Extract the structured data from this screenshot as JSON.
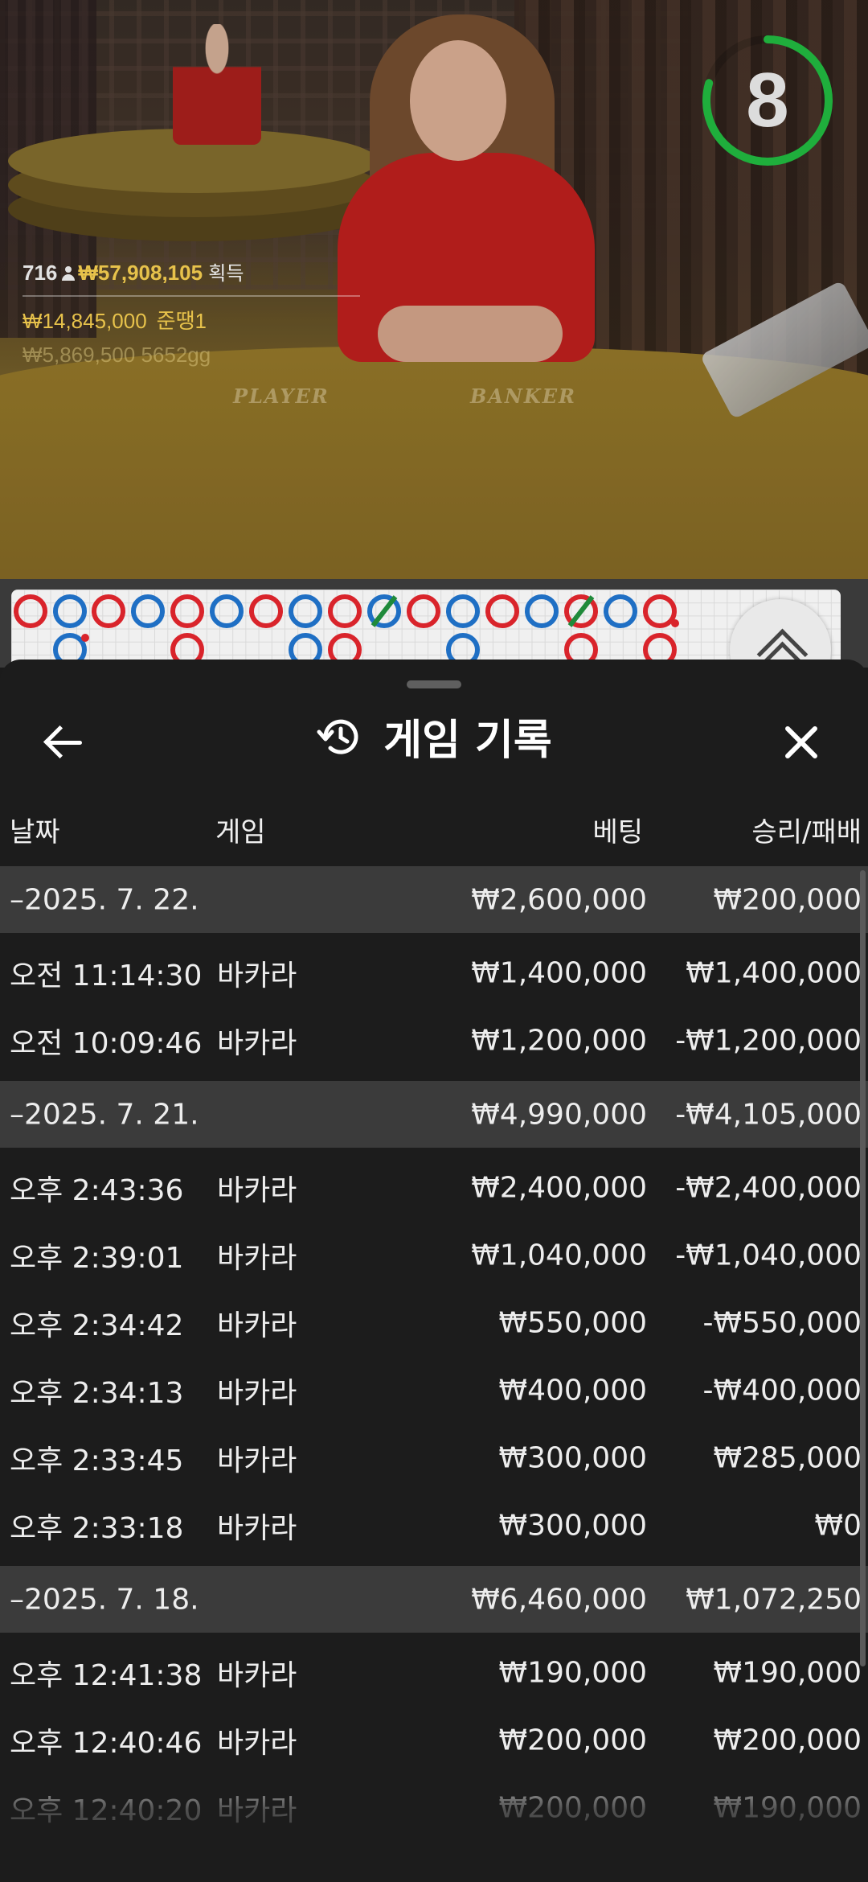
{
  "video": {
    "countdown": "8",
    "stats": {
      "players": "716",
      "total_win": "₩57,908,105",
      "total_win_label": "획득",
      "top_win_amount": "₩14,845,000",
      "top_win_user": "준땡1",
      "second_win_amount": "₩5,869,500",
      "second_win_user": "5652gg"
    },
    "table_labels": {
      "player": "PLAYER",
      "banker": "BANKER"
    }
  },
  "bead_road": {
    "colors": {
      "banker": "#d9242b",
      "player": "#1f6fc4",
      "tie": "#1f8a3a"
    }
  },
  "history": {
    "title": "게임 기록",
    "columns": {
      "date": "날짜",
      "game": "게임",
      "bet": "베팅",
      "result": "승리/패배"
    },
    "groups": [
      {
        "date": "–2025. 7. 22.",
        "bet_total": "₩2,600,000",
        "result_total": "₩200,000",
        "items": [
          {
            "time": "오전 11:14:30",
            "game": "바카라",
            "bet": "₩1,400,000",
            "result": "₩1,400,000"
          },
          {
            "time": "오전 10:09:46",
            "game": "바카라",
            "bet": "₩1,200,000",
            "result": "-₩1,200,000"
          }
        ]
      },
      {
        "date": "–2025. 7. 21.",
        "bet_total": "₩4,990,000",
        "result_total": "-₩4,105,000",
        "items": [
          {
            "time": "오후 2:43:36",
            "game": "바카라",
            "bet": "₩2,400,000",
            "result": "-₩2,400,000"
          },
          {
            "time": "오후 2:39:01",
            "game": "바카라",
            "bet": "₩1,040,000",
            "result": "-₩1,040,000"
          },
          {
            "time": "오후 2:34:42",
            "game": "바카라",
            "bet": "₩550,000",
            "result": "-₩550,000"
          },
          {
            "time": "오후 2:34:13",
            "game": "바카라",
            "bet": "₩400,000",
            "result": "-₩400,000"
          },
          {
            "time": "오후 2:33:45",
            "game": "바카라",
            "bet": "₩300,000",
            "result": "₩285,000"
          },
          {
            "time": "오후 2:33:18",
            "game": "바카라",
            "bet": "₩300,000",
            "result": "₩0"
          }
        ]
      },
      {
        "date": "–2025. 7. 18.",
        "bet_total": "₩6,460,000",
        "result_total": "₩1,072,250",
        "items": [
          {
            "time": "오후 12:41:38",
            "game": "바카라",
            "bet": "₩190,000",
            "result": "₩190,000"
          },
          {
            "time": "오후 12:40:46",
            "game": "바카라",
            "bet": "₩200,000",
            "result": "₩200,000"
          },
          {
            "time": "오후 12:40:20",
            "game": "바카라",
            "bet": "₩200,000",
            "result": "₩190,000"
          }
        ]
      }
    ]
  }
}
